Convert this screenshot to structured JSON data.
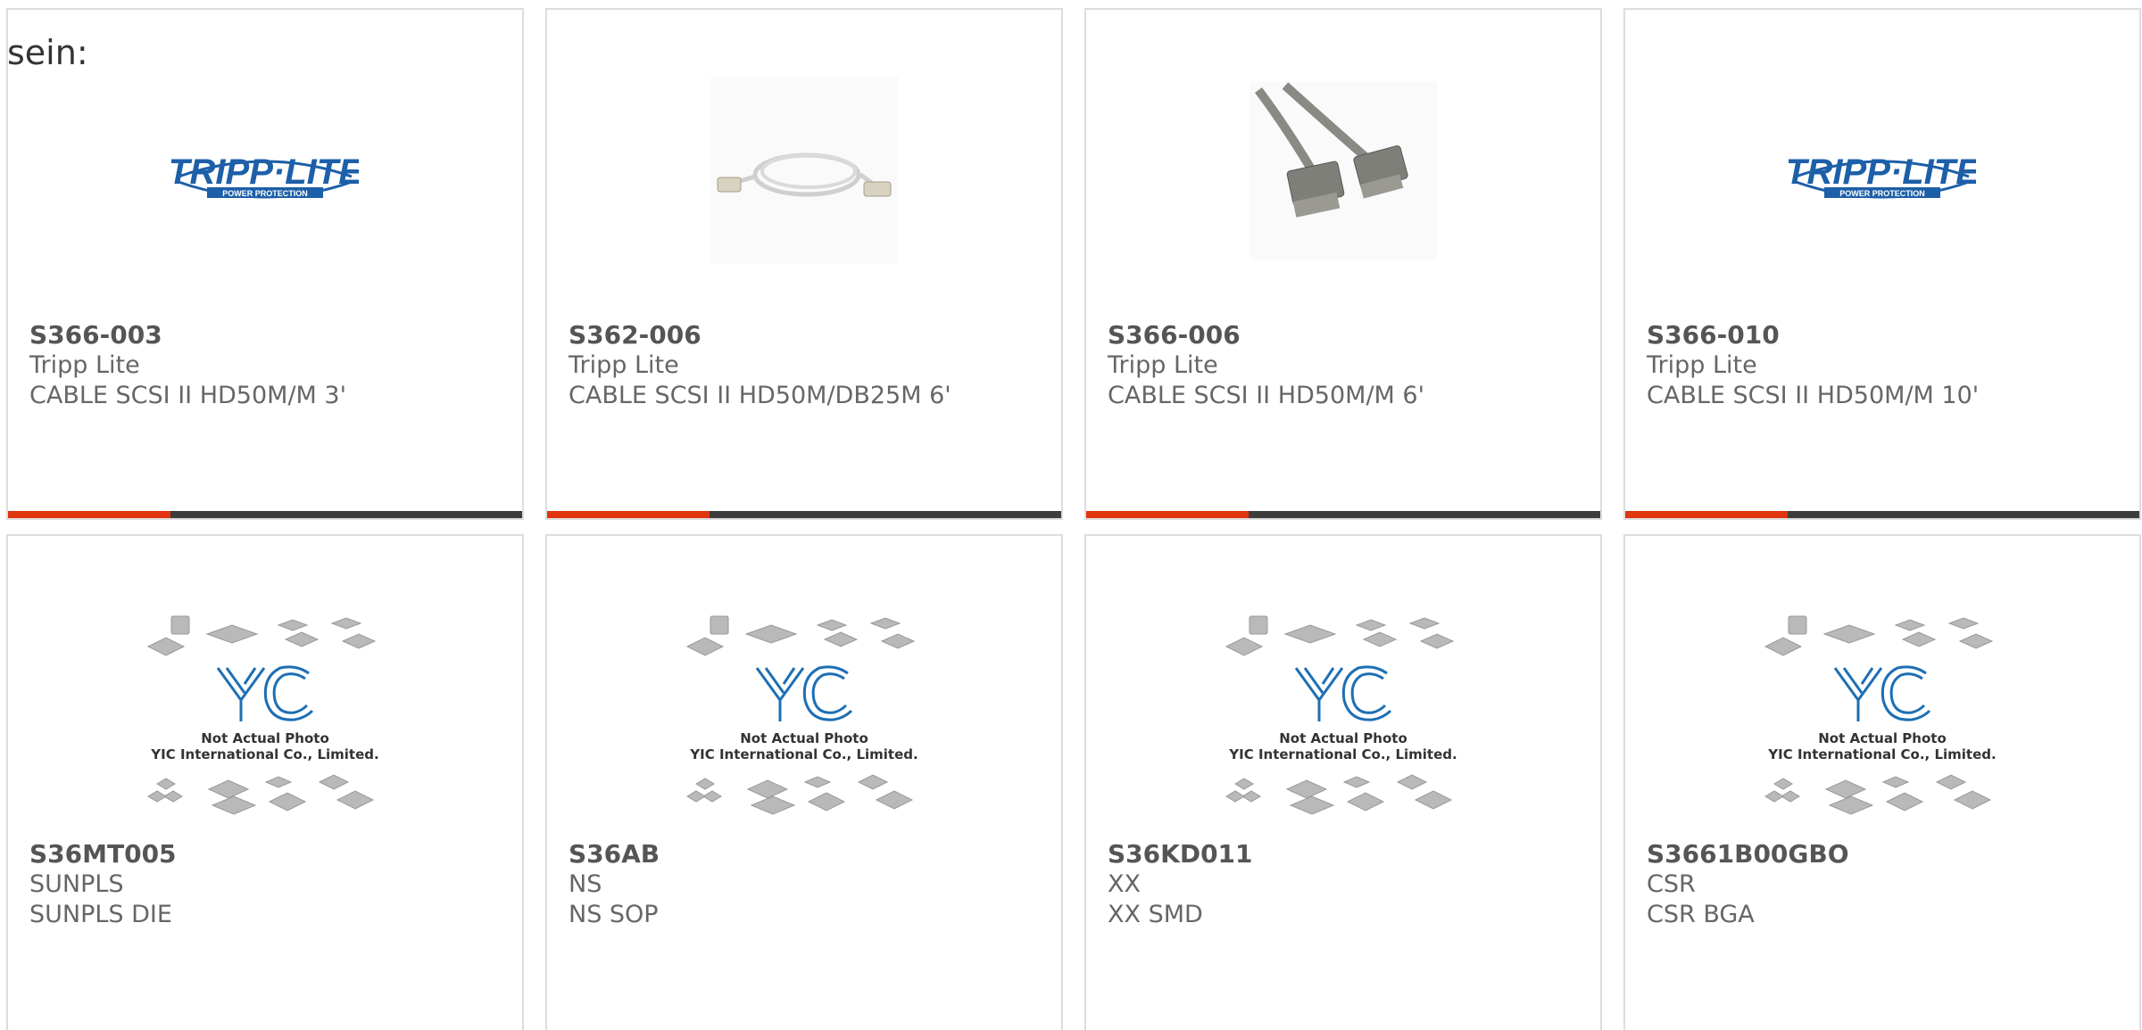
{
  "intro_text": "sein:",
  "colors": {
    "accent_bar": "#e0350e",
    "bar_dark": "#3d3d3d",
    "card_border": "#dddddd"
  },
  "products": [
    {
      "part": "S366-003",
      "brand": "Tripp Lite",
      "desc": "CABLE SCSI II HD50M/M 3'",
      "image": "tripp-lite-logo"
    },
    {
      "part": "S362-006",
      "brand": "Tripp Lite",
      "desc": "CABLE SCSI II HD50M/DB25M 6'",
      "image": "cable-coiled-photo"
    },
    {
      "part": "S366-006",
      "brand": "Tripp Lite",
      "desc": "CABLE SCSI II HD50M/M 6'",
      "image": "cable-connectors-photo"
    },
    {
      "part": "S366-010",
      "brand": "Tripp Lite",
      "desc": "CABLE SCSI II HD50M/M 10'",
      "image": "tripp-lite-logo"
    },
    {
      "part": "S36MT005",
      "brand": "SUNPLS",
      "desc": "SUNPLS DIE",
      "image": "yic-placeholder"
    },
    {
      "part": "S36AB",
      "brand": "NS",
      "desc": "NS SOP",
      "image": "yic-placeholder"
    },
    {
      "part": "S36KD011",
      "brand": "XX",
      "desc": "XX SMD",
      "image": "yic-placeholder"
    },
    {
      "part": "S3661B00GBO",
      "brand": "CSR",
      "desc": "CSR BGA",
      "image": "yic-placeholder"
    }
  ],
  "tripp_logo": {
    "word": "TRIPP·LITE",
    "tagline": "POWER PROTECTION"
  },
  "yic_placeholder": {
    "logo": "YIC",
    "line1": "Not Actual Photo",
    "line2": "YIC International Co., Limited."
  }
}
